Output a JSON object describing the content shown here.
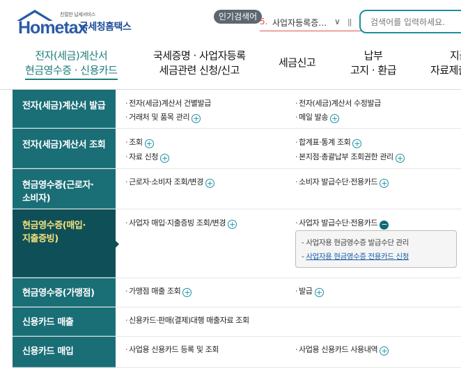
{
  "header": {
    "logo_tagline": "친절한 납세서비스",
    "logo_text": "Hometax",
    "logo_sub": "국세청홈택스",
    "popular_label": "인기검색어",
    "popular_rank": "5.",
    "popular_word": "사업자등록증…",
    "search_placeholder": "검색어를 입력하세요."
  },
  "gnb": [
    {
      "line1": "전자(세금)계산서",
      "line2": "현금영수증 · 신용카드"
    },
    {
      "line1": "국세증명 · 사업자등록",
      "line2": "세금관련 신청/신고"
    },
    {
      "line1": "세금신고",
      "line2": ""
    },
    {
      "line1": "납부",
      "line2": "고지 · 환급"
    },
    {
      "line1": "지급",
      "line2": "자료제출"
    }
  ],
  "rows": [
    {
      "title": "전자(세금)계산서 발급",
      "left": [
        "전자(세금)계산서 건별발급",
        "거래처 및 품목 관리"
      ],
      "right": [
        "전자(세금)계산서 수정발급",
        "메일 발송"
      ]
    },
    {
      "title": "전자(세금)계산서 조회",
      "left": [
        "조회",
        "자료 신청"
      ],
      "right": [
        "합계표·통계 조회",
        "본지점·총괄납부 조회권한 관리"
      ]
    },
    {
      "title": "현금영수증(근로자·소비자)",
      "left": [
        "근로자·소비자 조회/변경"
      ],
      "right": [
        "소비자 발급수단·전용카드"
      ]
    },
    {
      "title": "현금영수증(매입·지출증빙)",
      "left": [
        "사업자 매입·지출증빙 조회/변경"
      ],
      "right": [
        "사업자 발급수단·전용카드"
      ],
      "sub": [
        "사업자용 현금영수증 발급수단 관리",
        "사업자용 현금영수증 전용카드 신청"
      ]
    },
    {
      "title": "현금영수증(가맹점)",
      "left": [
        "가맹점 매출 조회"
      ],
      "right": [
        "발급"
      ]
    },
    {
      "title": "신용카드 매출",
      "left": [
        "신용카드·판매(결제)대행 매출자료 조회"
      ],
      "right": []
    },
    {
      "title": "신용카드 매입",
      "left": [
        "사업용 신용카드 등록 및 조회"
      ],
      "right": [
        "사업용 신용카드 사용내역"
      ]
    }
  ],
  "colors": {
    "teal": "#1a6e76",
    "active_row": "#0f4f57",
    "active_text": "#f6e37a",
    "gnb_active": "#1b7d7a",
    "search_border": "#1a8fa0"
  }
}
